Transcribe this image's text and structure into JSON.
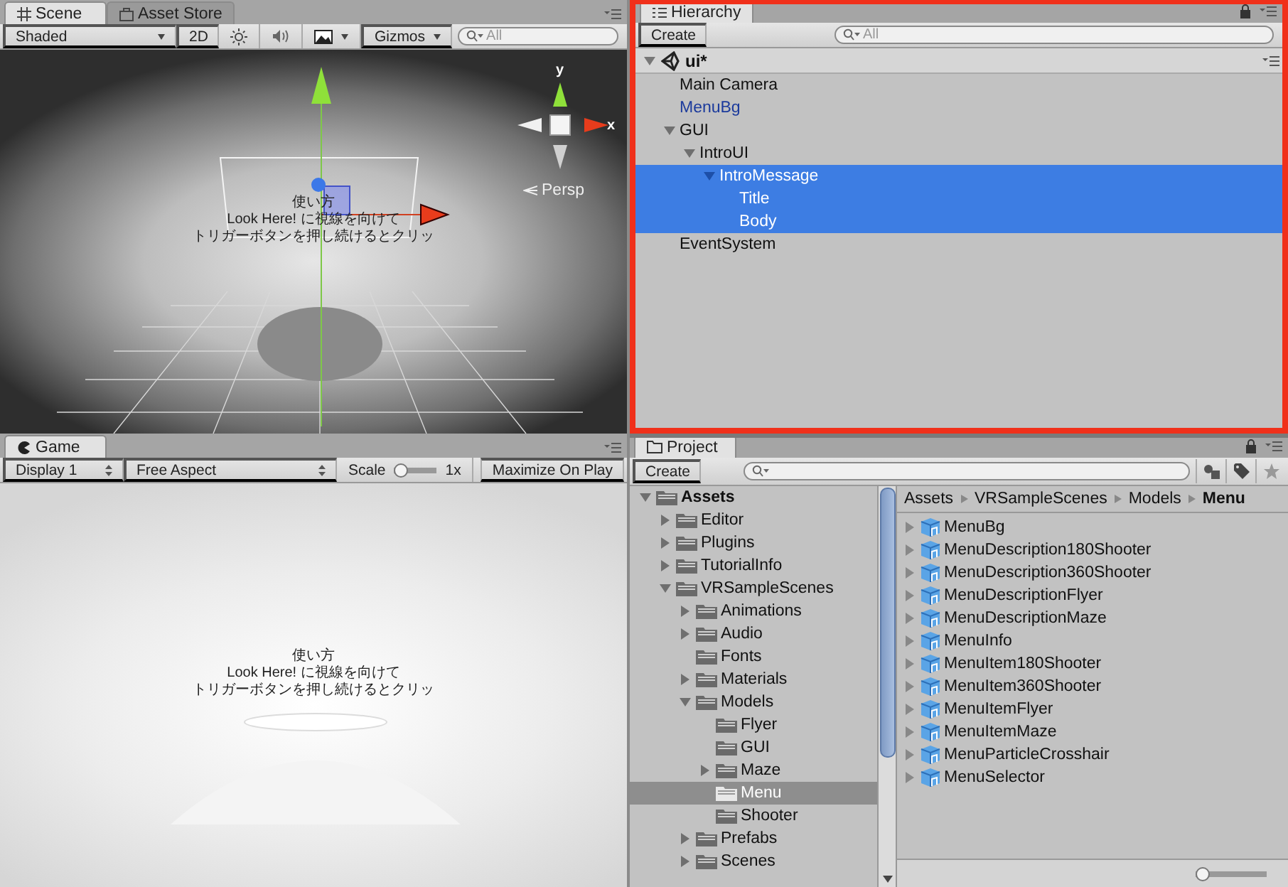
{
  "scene": {
    "tabs": [
      {
        "label": "Scene",
        "selected": true
      },
      {
        "label": "Asset Store",
        "selected": false
      }
    ],
    "toolbar": {
      "shading": "Shaded",
      "mode_2d": "2D",
      "gizmos": "Gizmos",
      "search_placeholder": "All"
    },
    "viewport": {
      "captions": [
        "使い方",
        "Look Here! に視線を向けて",
        "トリガーボタンを押し続けるとクリッ"
      ],
      "axis_labels": [
        "y",
        "x"
      ],
      "projection": "Persp"
    }
  },
  "game": {
    "tabs": [
      {
        "label": "Game",
        "selected": true
      }
    ],
    "toolbar": {
      "display": "Display 1",
      "aspect": "Free Aspect",
      "scale_label": "Scale",
      "scale": {
        "level": 0
      },
      "scale_value": "1x",
      "maximize": "Maximize On Play"
    },
    "viewport": {
      "captions": [
        "使い方",
        "Look Here! に視線を向けて",
        "トリガーボタンを押し続けるとクリッ"
      ]
    }
  },
  "hierarchy": {
    "tabs": [
      {
        "label": "Hierarchy",
        "selected": true
      }
    ],
    "create": "Create",
    "search_placeholder": "All",
    "scene": {
      "name": "ui*",
      "expanded": true
    },
    "items": [
      {
        "name": "Main Camera",
        "kind": "object",
        "expanded": false,
        "has_children": false,
        "selected": false
      },
      {
        "name": "MenuBg",
        "kind": "prefab",
        "expanded": false,
        "has_children": false,
        "selected": false
      },
      {
        "name": "GUI",
        "kind": "object",
        "expanded": true,
        "has_children": true,
        "selected": false,
        "children": [
          {
            "name": "IntroUI",
            "kind": "object",
            "expanded": true,
            "has_children": true,
            "selected": false,
            "children": [
              {
                "name": "IntroMessage",
                "kind": "object",
                "expanded": true,
                "has_children": true,
                "selected": true,
                "children": [
                  {
                    "name": "Title",
                    "kind": "object",
                    "expanded": false,
                    "has_children": false,
                    "selected": true
                  },
                  {
                    "name": "Body",
                    "kind": "object",
                    "expanded": false,
                    "has_children": false,
                    "selected": true
                  }
                ]
              }
            ]
          }
        ]
      },
      {
        "name": "EventSystem",
        "kind": "object",
        "expanded": false,
        "has_children": false,
        "selected": false
      }
    ]
  },
  "project": {
    "tabs": [
      {
        "label": "Project",
        "selected": true
      }
    ],
    "create": "Create",
    "folders": [
      {
        "name": "Assets",
        "expanded": true,
        "has_children": true,
        "selected": false,
        "children": [
          {
            "name": "Editor",
            "expanded": false,
            "has_children": true,
            "selected": false
          },
          {
            "name": "Plugins",
            "expanded": false,
            "has_children": true,
            "selected": false
          },
          {
            "name": "TutorialInfo",
            "expanded": false,
            "has_children": true,
            "selected": false
          },
          {
            "name": "VRSampleScenes",
            "expanded": true,
            "has_children": true,
            "selected": false,
            "children": [
              {
                "name": "Animations",
                "expanded": false,
                "has_children": true,
                "selected": false
              },
              {
                "name": "Audio",
                "expanded": false,
                "has_children": true,
                "selected": false
              },
              {
                "name": "Fonts",
                "expanded": false,
                "has_children": false,
                "selected": false
              },
              {
                "name": "Materials",
                "expanded": false,
                "has_children": true,
                "selected": false
              },
              {
                "name": "Models",
                "expanded": true,
                "has_children": true,
                "selected": false,
                "children": [
                  {
                    "name": "Flyer",
                    "expanded": false,
                    "has_children": false,
                    "selected": false
                  },
                  {
                    "name": "GUI",
                    "expanded": false,
                    "has_children": false,
                    "selected": false
                  },
                  {
                    "name": "Maze",
                    "expanded": false,
                    "has_children": true,
                    "selected": false
                  },
                  {
                    "name": "Menu",
                    "expanded": false,
                    "has_children": false,
                    "selected": true
                  },
                  {
                    "name": "Shooter",
                    "expanded": false,
                    "has_children": false,
                    "selected": false
                  }
                ]
              },
              {
                "name": "Prefabs",
                "expanded": false,
                "has_children": true,
                "selected": false
              },
              {
                "name": "Scenes",
                "expanded": false,
                "has_children": true,
                "selected": false
              }
            ]
          }
        ]
      }
    ],
    "breadcrumb": [
      "Assets",
      "VRSampleScenes",
      "Models",
      "Menu"
    ],
    "assets": [
      "MenuBg",
      "MenuDescription180Shooter",
      "MenuDescription360Shooter",
      "MenuDescriptionFlyer",
      "MenuDescriptionMaze",
      "MenuInfo",
      "MenuItem180Shooter",
      "MenuItem360Shooter",
      "MenuItemFlyer",
      "MenuItemMaze",
      "MenuParticleCrosshair",
      "MenuSelector"
    ],
    "icon_size": {
      "level": 0
    }
  }
}
